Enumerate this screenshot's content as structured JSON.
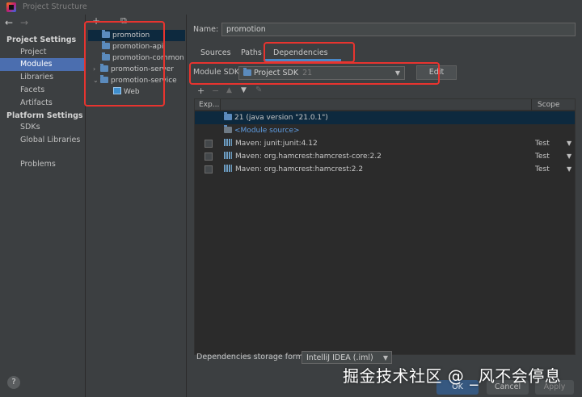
{
  "window": {
    "title": "Project Structure"
  },
  "colors": {
    "selected": "#4b6eaf",
    "highlight": "#e8342f",
    "link": "#5e9de3"
  },
  "left_nav": {
    "back_glyph": "←",
    "forward_glyph": "→",
    "project_settings_header": "Project Settings",
    "project_settings": [
      "Project",
      "Modules",
      "Libraries",
      "Facets",
      "Artifacts"
    ],
    "selected": "Modules",
    "platform_settings_header": "Platform Settings",
    "platform_settings": [
      "SDKs",
      "Global Libraries"
    ],
    "problems": "Problems",
    "help": "?"
  },
  "module_tree": {
    "toolbar": [
      "+",
      "⧉"
    ],
    "items": [
      {
        "label": "promotion",
        "selected": true
      },
      {
        "label": "promotion-api"
      },
      {
        "label": "promotion-common"
      },
      {
        "label": "promotion-server",
        "expand": "›"
      },
      {
        "label": "promotion-service",
        "expand": "⌄"
      },
      {
        "label": "Web"
      }
    ]
  },
  "main": {
    "name_label": "Name:",
    "name_value": "promotion",
    "tabs": [
      "Sources",
      "Paths",
      "Dependencies"
    ],
    "active_tab": "Dependencies",
    "sdk_label": "Module SDK:",
    "sdk_value": "Project SDK",
    "sdk_version": "21",
    "edit_button": "Edit",
    "toolbar": [
      "+",
      "−",
      "▲",
      "▼",
      "✎"
    ],
    "table": {
      "col_export": "Exp...",
      "col_scope": "Scope",
      "rows": [
        {
          "name": "21 (java version \"21.0.1\")",
          "selected": true
        },
        {
          "name": "<Module source>"
        },
        {
          "name": "Maven: junit:junit:4.12",
          "scope": "Test"
        },
        {
          "name": "Maven: org.hamcrest:hamcrest-core:2.2",
          "scope": "Test"
        },
        {
          "name": "Maven: org.hamcrest:hamcrest:2.2",
          "scope": "Test"
        }
      ]
    },
    "storage_label": "Dependencies storage format:",
    "storage_value": "IntelliJ IDEA (.iml)"
  },
  "buttons": {
    "ok": "OK",
    "cancel": "Cancel",
    "apply": "Apply"
  },
  "watermark": "掘金技术社区 @ _风不会停息"
}
